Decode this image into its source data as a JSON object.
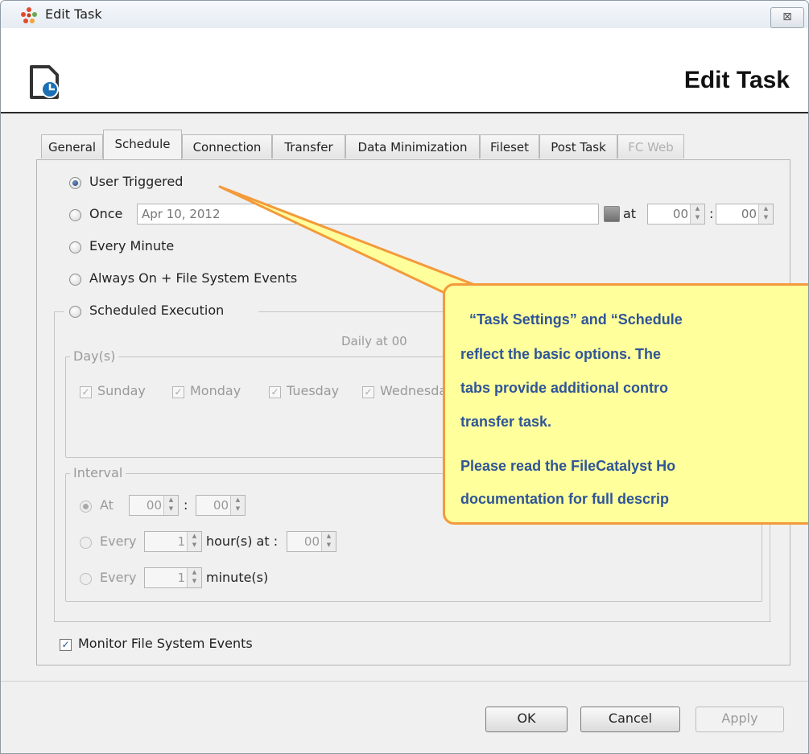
{
  "window": {
    "title": "Edit Task",
    "close_label": "⊠"
  },
  "header": {
    "title": "Edit Task"
  },
  "tabs": [
    {
      "label": "General"
    },
    {
      "label": "Schedule"
    },
    {
      "label": "Connection"
    },
    {
      "label": "Transfer"
    },
    {
      "label": "Data Minimization"
    },
    {
      "label": "Fileset"
    },
    {
      "label": "Post Task"
    },
    {
      "label": "FC Web"
    }
  ],
  "schedule": {
    "options": {
      "user_triggered": "User Triggered",
      "once": "Once",
      "every_minute": "Every Minute",
      "always_on": "Always On + File System Events",
      "scheduled_execution": "Scheduled Execution"
    },
    "selected": "User Triggered",
    "once_date": "Apr 10, 2012",
    "at_label": "at",
    "once_hour": "00",
    "once_minute": "00",
    "colon": ":",
    "summary": "Daily at 00",
    "days": {
      "legend": "Day(s)",
      "items": [
        "Sunday",
        "Monday",
        "Tuesday",
        "Wednesday"
      ]
    },
    "interval": {
      "legend": "Interval",
      "at_label": "At",
      "at_hour": "00",
      "at_minute": "00",
      "every_label": "Every",
      "every_hours_value": "1",
      "hours_at_label": "hour(s) at :",
      "hours_at_minute": "00",
      "every_minutes_value": "1",
      "minutes_label": "minute(s)"
    },
    "monitor_label": "Monitor File System Events"
  },
  "buttons": {
    "ok": "OK",
    "cancel": "Cancel",
    "apply": "Apply"
  },
  "callout": {
    "line1": "“Task Settings” and “Schedule",
    "line2": "reflect the basic options.  The",
    "line3": "tabs provide additional contro",
    "line4": "transfer task.",
    "line5": "Please read the FileCatalyst Ho",
    "line6": "documentation for full descrip"
  },
  "colors": {
    "callout_fill": "#ffff9c",
    "callout_border": "#f39a3b",
    "callout_text": "#2f5597"
  },
  "icons": {
    "app": "app-logo-icon",
    "task": "task-clock-icon"
  }
}
